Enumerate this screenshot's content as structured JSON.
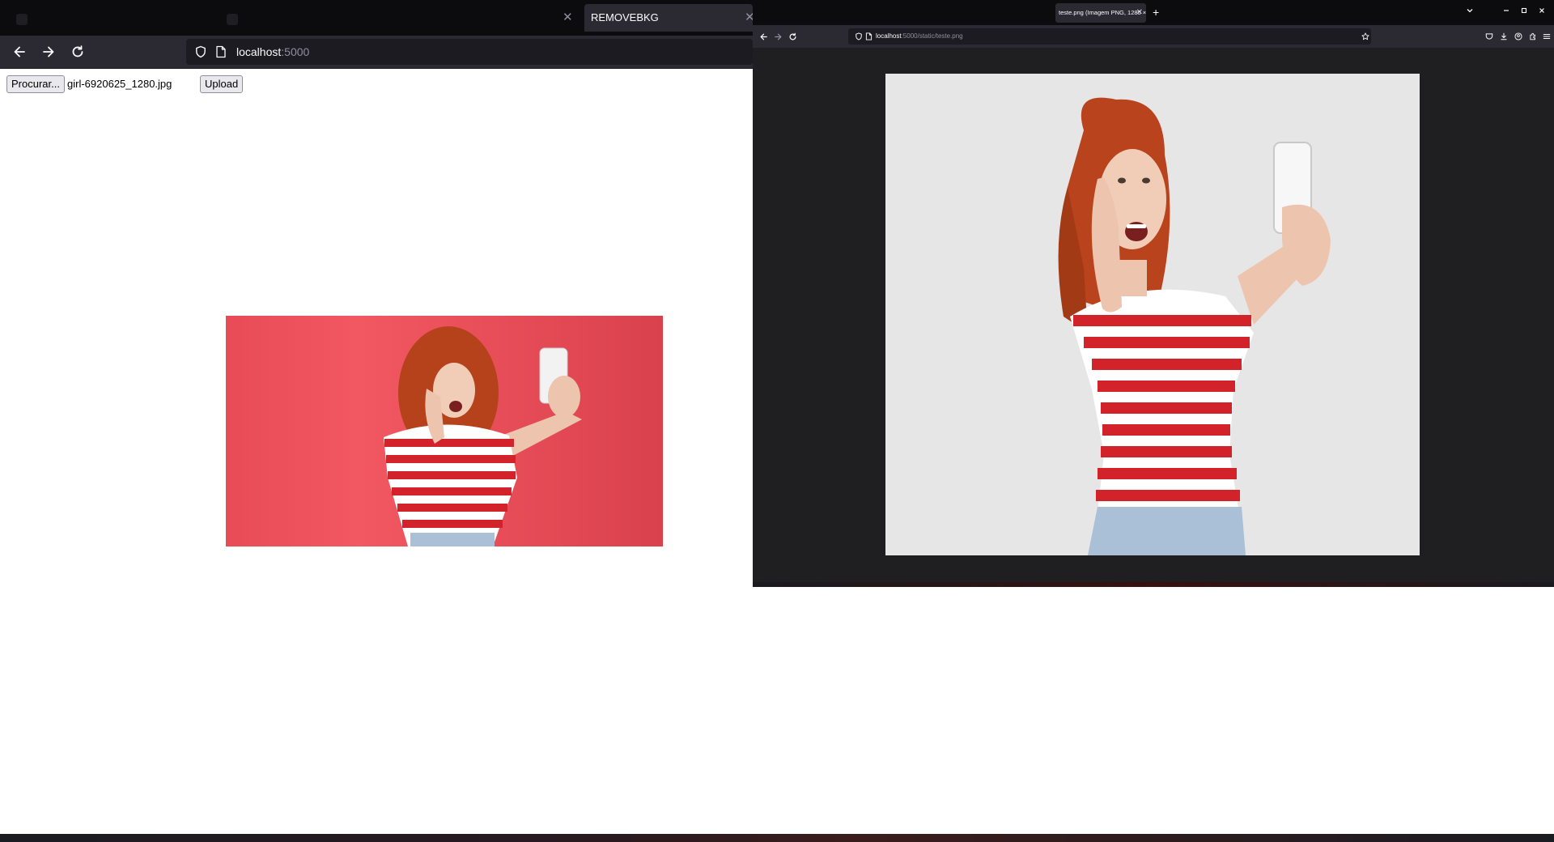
{
  "left_browser": {
    "active_tab_title": "REMOVEBKG",
    "url_host": "localhost",
    "url_port": ":5000",
    "page": {
      "browse_button": "Procurar...",
      "file_name": "girl-6920625_1280.jpg",
      "upload_button": "Upload"
    }
  },
  "right_browser": {
    "tab_title": "teste.png (Imagem PNG, 1280 × 8…",
    "url_host": "localhost",
    "url_path": ":5000/static/teste.png"
  },
  "colors": {
    "preview_background": "#e34f59",
    "result_background": "#e6e6e6",
    "shirt_red": "#d2232a",
    "hair": "#b8431c"
  }
}
